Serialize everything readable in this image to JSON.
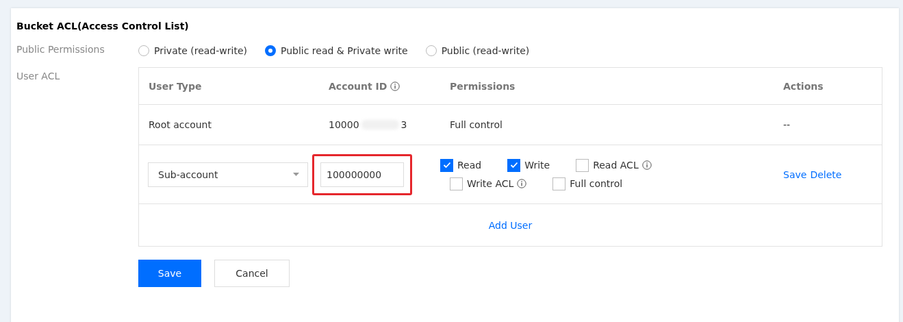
{
  "title": "Bucket ACL(Access Control List)",
  "public_permissions": {
    "label": "Public Permissions",
    "options": [
      {
        "label": "Private (read-write)",
        "selected": false
      },
      {
        "label": "Public read & Private write",
        "selected": true
      },
      {
        "label": "Public (read-write)",
        "selected": false
      }
    ]
  },
  "user_acl": {
    "label": "User ACL",
    "columns": [
      {
        "label": "User Type",
        "info": false
      },
      {
        "label": "Account ID",
        "info": true
      },
      {
        "label": "Permissions",
        "info": false
      },
      {
        "label": "Actions",
        "info": false
      }
    ],
    "rows": [
      {
        "kind": "static",
        "user_type": "Root account",
        "account_id_start": "10000",
        "account_id_end": "3",
        "permissions": "Full control",
        "actions": "--"
      },
      {
        "kind": "edit",
        "user_type": "Sub-account",
        "account_id": "100000000",
        "highlighted": true,
        "permissions": [
          {
            "label": "Read",
            "checked": true,
            "info": false
          },
          {
            "label": "Write",
            "checked": true,
            "info": false
          },
          {
            "label": "Read ACL",
            "checked": false,
            "info": true
          },
          {
            "label": "Write ACL",
            "checked": false,
            "info": true
          },
          {
            "label": "Full control",
            "checked": false,
            "info": false
          }
        ],
        "actions": [
          "Save",
          "Delete"
        ]
      }
    ],
    "add_link": "Add User"
  },
  "buttons": [
    {
      "label": "Save",
      "kind": "primary"
    },
    {
      "label": "Cancel",
      "kind": "default"
    }
  ]
}
